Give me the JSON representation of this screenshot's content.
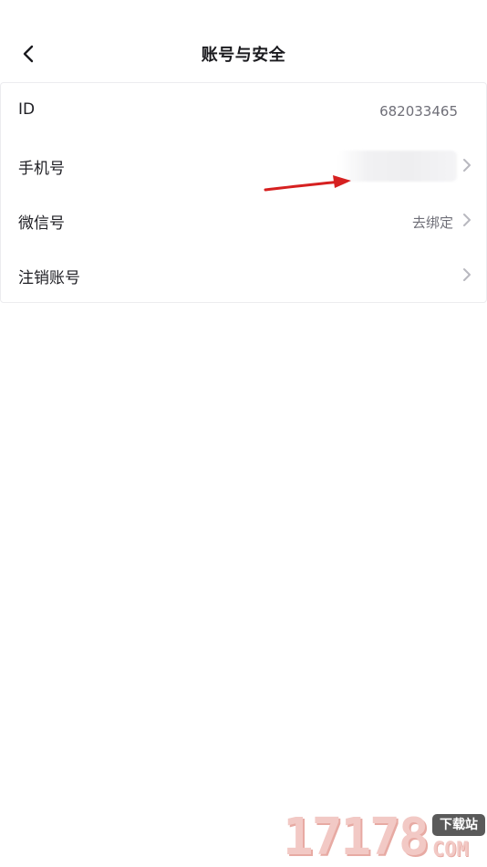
{
  "header": {
    "title": "账号与安全",
    "back_icon": "chevron-left-icon"
  },
  "rows": [
    {
      "label": "ID",
      "value": "682033465",
      "has_chevron": false
    },
    {
      "label": "手机号",
      "value": "",
      "has_chevron": true,
      "value_obscured": true
    },
    {
      "label": "微信号",
      "value": "去绑定",
      "has_chevron": true
    },
    {
      "label": "注销账号",
      "value": "",
      "has_chevron": true
    }
  ],
  "annotation": {
    "type": "red-arrow",
    "color": "#d62020"
  },
  "watermark": {
    "digits": "17178",
    "badge": "下载站",
    "domain": "COM"
  },
  "colors": {
    "text_primary": "#1f1f24",
    "text_secondary": "#6f6f78",
    "chevron": "#b8b8bf",
    "border": "#ececef"
  }
}
